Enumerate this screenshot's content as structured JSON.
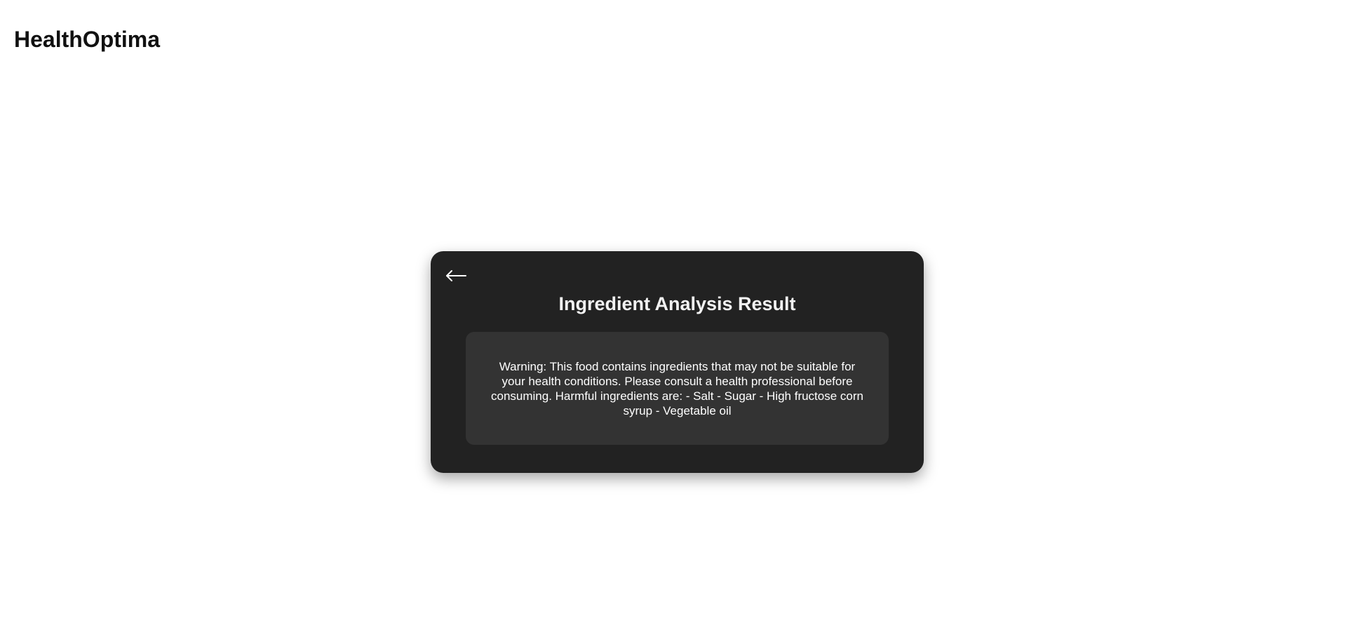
{
  "header": {
    "title": "HealthOptima"
  },
  "result_card": {
    "back_icon": "arrow-left-icon",
    "title": "Ingredient Analysis Result",
    "message": "Warning: This food contains ingredients that may not be suitable for your health conditions. Please consult a health professional before consuming. Harmful ingredients are: - Salt - Sugar - High fructose corn syrup - Vegetable oil"
  },
  "colors": {
    "page_background": "#ffffff",
    "card_background": "#222222",
    "message_background": "#333333",
    "text_light": "#ffffff"
  }
}
